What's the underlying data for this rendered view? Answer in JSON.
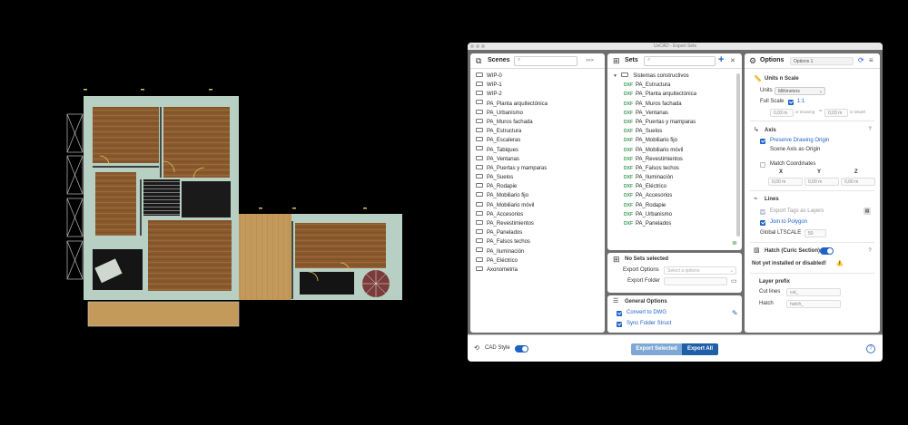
{
  "window_title": "UsCAD - Export Sets",
  "scenes": {
    "title": "Scenes",
    "expand_label": ">>>",
    "items": [
      "WIP-0",
      "WIP-1",
      "WIP-2",
      "PA_Planta arquitectónica",
      "PA_Urbanismo",
      "PA_Muros fachada",
      "PA_Estructura",
      "PA_Escaleras",
      "PA_Tabiques",
      "PA_Ventanas",
      "PA_Puertas y mamparas",
      "PA_Suelos",
      "PA_Rodapie",
      "PA_Mobiliario fijo",
      "PA_Mobiliario móvil",
      "PA_Accesorios",
      "PA_Revestimientos",
      "PA_Panelados",
      "PA_Falsos techos",
      "PA_Iluminación",
      "PA_Eléctrico",
      "Axonometría"
    ]
  },
  "sets": {
    "title": "Sets",
    "add_label": "+",
    "close_label": "✕",
    "group_label": "Sistemas constructivos",
    "tag_label": "DXF",
    "items": [
      "PA_Estructura",
      "PA_Planta arquitectónica",
      "PA_Muros fachada",
      "PA_Ventanas",
      "PA_Puertas y mamparas",
      "PA_Suelos",
      "PA_Mobiliario fijo",
      "PA_Mobiliario móvil",
      "PA_Revestimientos",
      "PA_Falsos techos",
      "PA_Iluminación",
      "PA_Eléctrico",
      "PA_Accesorios",
      "PA_Rodapie",
      "PA_Urbanismo",
      "PA_Panelados"
    ]
  },
  "no_sets": {
    "title": "No Sets selected",
    "export_options_label": "Export Options",
    "export_options_placeholder": "Select a options",
    "export_folder_label": "Export Folder"
  },
  "general_options": {
    "title": "General Options",
    "convert_label": "Convert to DWG",
    "sync_label": "Sync Folder Struct"
  },
  "options": {
    "title": "Options",
    "preset": "Options 1",
    "units_scale": {
      "title": "Units n Scale",
      "units_label": "Units",
      "units_value": "Millimeters",
      "full_scale_label": "Full Scale",
      "ratio": "1:1",
      "in_drawing_value": "0,03 m",
      "in_drawing_label": "in Drawing",
      "equals": "=",
      "in_model_value": "0,03 m",
      "in_model_label": "in Model"
    },
    "axis": {
      "title": "Axis",
      "preserve_label": "Preserve Drawing Origin",
      "scene_axis_label": "Scene Axis as Origin",
      "match_label": "Match Coordinates",
      "x_label": "X",
      "y_label": "Y",
      "z_label": "Z",
      "x_value": "0,00 m",
      "y_value": "0,00 m",
      "z_value": "0,00 m"
    },
    "lines": {
      "title": "Lines",
      "export_tags_label": "Export Tags as Layers",
      "join_label": "Join to Polygon",
      "ltscale_label": "Global LTSCALE",
      "ltscale_value": "50"
    },
    "hatch": {
      "title": "Hatch (Curic Section)",
      "status": "Not yet installed or disabled!",
      "warning_icon": "⚠️"
    },
    "layer_prefix": {
      "title": "Layer prefix",
      "cut_label": "Cut lines",
      "cut_value": "cut_",
      "hatch_label": "Hatch",
      "hatch_value": "hatch_"
    }
  },
  "footer": {
    "cad_style_label": "CAD Style",
    "export_selected_label": "Export Selected",
    "export_all_label": "Export All",
    "help_label": "?"
  },
  "colors": {
    "accent": "#1e62c8",
    "export_selected_bg": "#7fa9d4",
    "export_all_bg": "#1f5fa8",
    "warning": "#f2b705",
    "tag_green": "#3a9a55"
  }
}
